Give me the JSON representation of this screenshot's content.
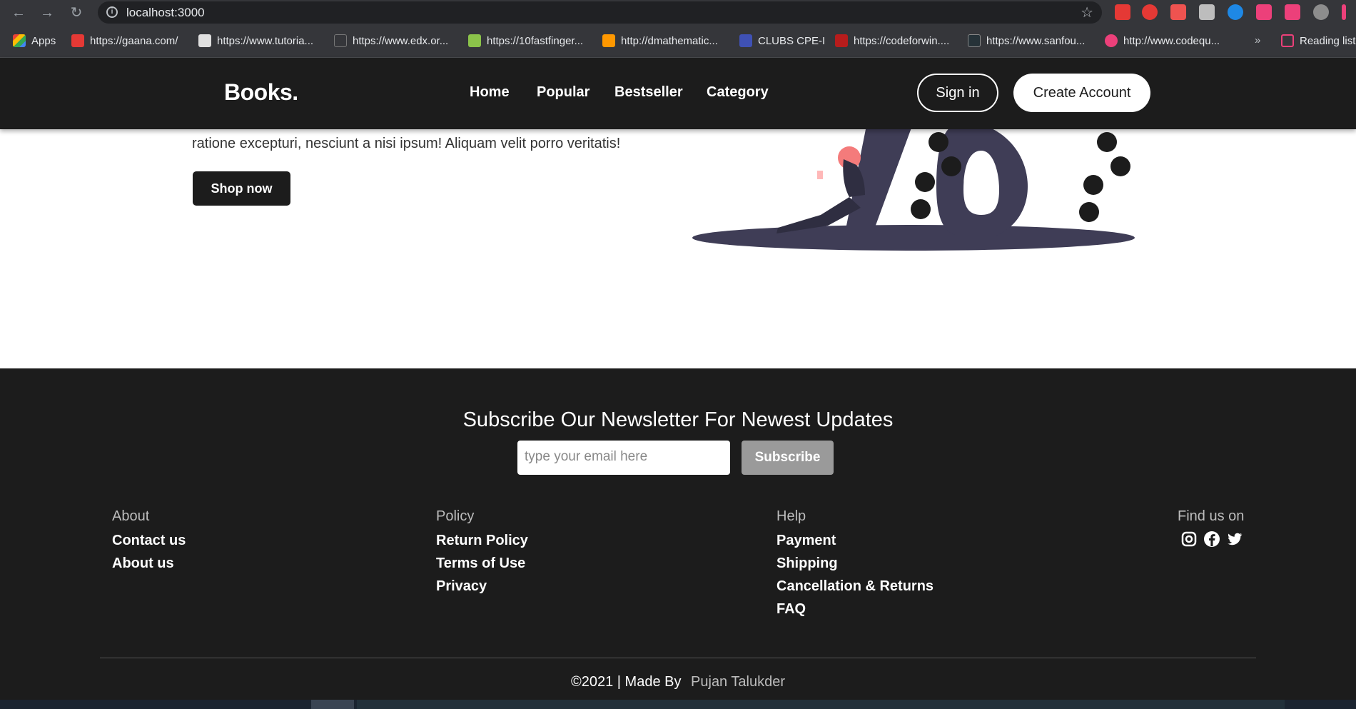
{
  "browser": {
    "url": "localhost:3000",
    "bookmarks": [
      {
        "label": "Apps",
        "color": "#ea4335"
      },
      {
        "label": "https://gaana.com/",
        "color": "#e53935"
      },
      {
        "label": "https://www.tutoria...",
        "color": "#e0e0e0"
      },
      {
        "label": "https://www.edx.or...",
        "color": "#35363a"
      },
      {
        "label": "https://10fastfinger...",
        "color": "#8bc34a"
      },
      {
        "label": "http://dmathematic...",
        "color": "#ff9800"
      },
      {
        "label": "CLUBS CPE-I",
        "color": "#3f51b5"
      },
      {
        "label": "https://codeforwin....",
        "color": "#b71c1c"
      },
      {
        "label": "https://www.sanfou...",
        "color": "#263238"
      },
      {
        "label": "http://www.codequ...",
        "color": "#ec407a"
      }
    ],
    "overflow": "»",
    "reading_list": "Reading list"
  },
  "header": {
    "logo": "Books.",
    "nav": [
      "Home",
      "Popular",
      "Bestseller",
      "Category"
    ],
    "signin": "Sign in",
    "create_account": "Create Account"
  },
  "hero": {
    "text": "ratione excepturi, nesciunt a nisi ipsum! Aliquam velit porro veritatis!",
    "shop_now": "Shop now"
  },
  "footer": {
    "newsletter_title": "Subscribe Our Newsletter For Newest Updates",
    "email_placeholder": "type your email here",
    "subscribe": "Subscribe",
    "columns": [
      {
        "heading": "About",
        "links": [
          "Contact us",
          "About us"
        ]
      },
      {
        "heading": "Policy",
        "links": [
          "Return Policy",
          "Terms of Use",
          "Privacy"
        ]
      },
      {
        "heading": "Help",
        "links": [
          "Payment",
          "Shipping",
          "Cancellation & Returns",
          "FAQ"
        ]
      }
    ],
    "find_us": "Find us on",
    "social": [
      "instagram-icon",
      "facebook-icon",
      "twitter-icon"
    ],
    "copyright": "©2021 | Made By",
    "author": "Pujan Talukder"
  },
  "colors": {
    "header_bg": "#1c1c1c",
    "accent_white": "#ffffff",
    "subscribe_button": "#9a9a9a"
  }
}
